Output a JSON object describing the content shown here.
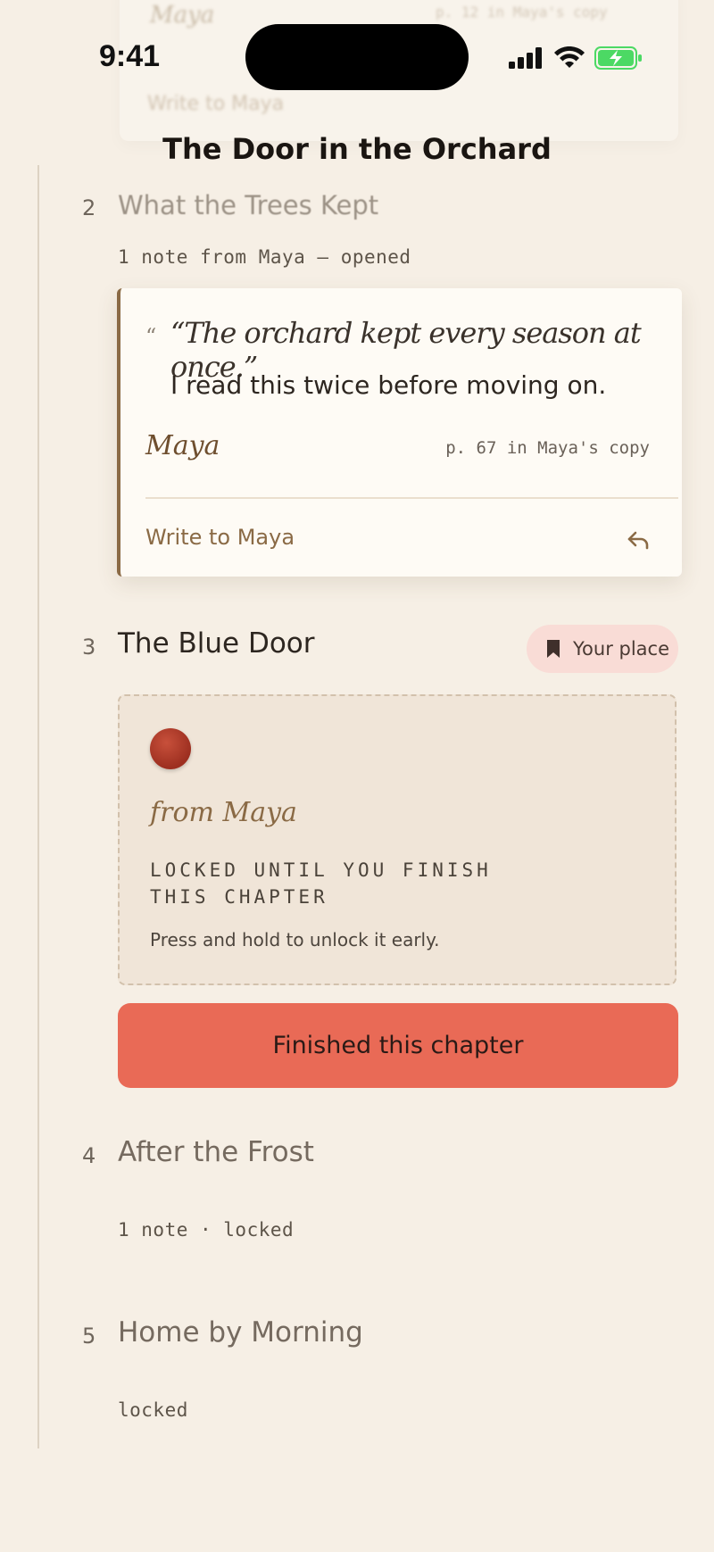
{
  "status_bar": {
    "time": "9:41"
  },
  "background_card": {
    "name": "Maya",
    "page_ref": "p. 12 in Maya's copy",
    "write_link": "Write to Maya"
  },
  "header": {
    "title": "The Door in the Orchard"
  },
  "chapters": [
    {
      "number": "2",
      "title": "What the Trees Kept",
      "meta": "1 note from Maya — opened",
      "note": {
        "quote_mark": "“",
        "quote": "“The orchard kept every season at once.”",
        "text": "I read this twice before moving on.",
        "signature": "Maya",
        "page_ref": "p. 67 in Maya's copy",
        "write_label": "Write to Maya"
      }
    },
    {
      "number": "3",
      "title": "The Blue Door",
      "badge": "Your place",
      "letter": {
        "from": "from Maya",
        "locked_message": "LOCKED UNTIL YOU FINISH THIS CHAPTER",
        "hint": "Press and hold to unlock it early."
      },
      "finish_button": "Finished this chapter"
    },
    {
      "number": "4",
      "title": "After the Frost",
      "meta": "1 note · locked"
    },
    {
      "number": "5",
      "title": "Home by Morning",
      "meta": "locked"
    }
  ],
  "colors": {
    "background": "#f6efe5",
    "accent_brown": "#8a6a45",
    "button_coral": "#e96a56",
    "badge_pink": "#f9dcd6",
    "battery_green": "#4cd964"
  },
  "icons": {
    "signal": "cellular-signal-icon",
    "wifi": "wifi-icon",
    "battery": "battery-charging-icon",
    "reply": "reply-arrow-icon",
    "bookmark": "bookmark-icon",
    "seal": "wax-seal-icon"
  }
}
